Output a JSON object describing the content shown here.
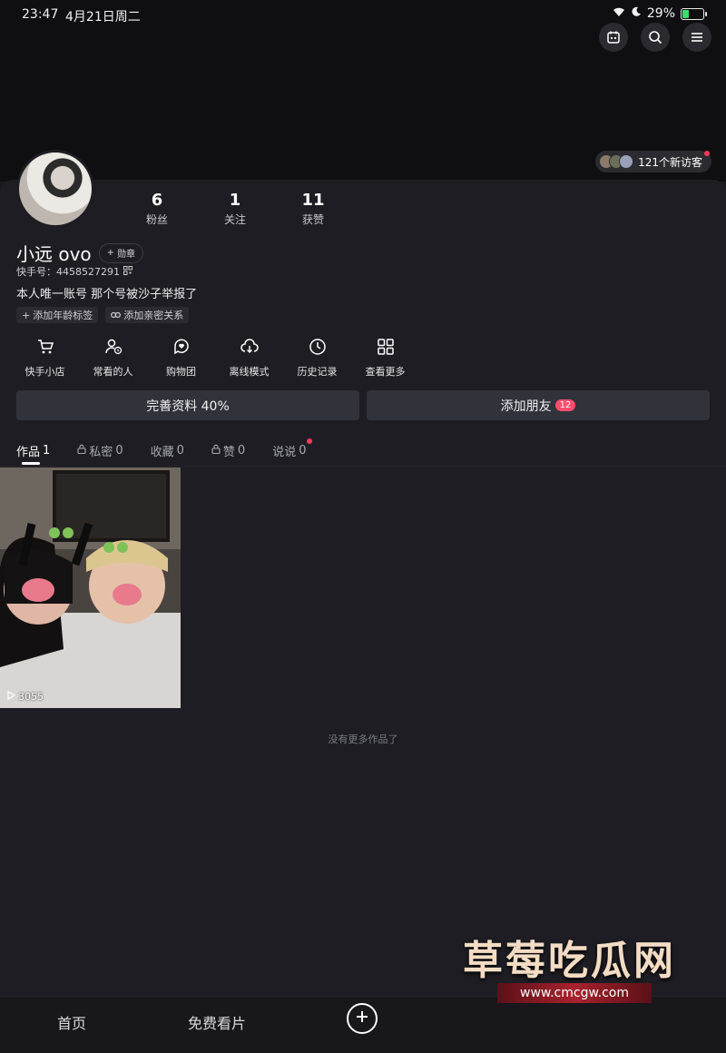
{
  "status": {
    "time": "23:47",
    "date": "4月21日周二",
    "battery": "29%",
    "battery_level": 0.29
  },
  "header_icons": [
    "calendar-icon",
    "search-icon",
    "menu-icon"
  ],
  "visitors": {
    "text": "121个新访客"
  },
  "stats": [
    {
      "num": "6",
      "label": "粉丝"
    },
    {
      "num": "1",
      "label": "关注"
    },
    {
      "num": "11",
      "label": "获赞"
    }
  ],
  "profile": {
    "name": "小远 ovo",
    "badge_label": "勋章",
    "kwai_id": "快手号：4458527291",
    "bio": "本人唯一账号 那个号被沙子举报了"
  },
  "tags": [
    {
      "label": "添加年龄标签",
      "icon": "plus-icon"
    },
    {
      "label": "添加亲密关系",
      "icon": "link-icon"
    }
  ],
  "shortcuts": [
    {
      "label": "快手小店",
      "icon": "cart-icon"
    },
    {
      "label": "常看的人",
      "icon": "person-clock-icon"
    },
    {
      "label": "购物团",
      "icon": "heart-bubble-icon"
    },
    {
      "label": "离线模式",
      "icon": "download-icon"
    },
    {
      "label": "历史记录",
      "icon": "clock-icon"
    },
    {
      "label": "查看更多",
      "icon": "grid-icon"
    }
  ],
  "actions": {
    "complete_profile": "完善资料 40%",
    "add_friend": "添加朋友",
    "add_friend_count": "12"
  },
  "tabs": [
    {
      "label": "作品",
      "count": "1",
      "locked": false,
      "active": true
    },
    {
      "label": "私密",
      "count": "0",
      "locked": true,
      "active": false
    },
    {
      "label": "收藏",
      "count": "0",
      "locked": false,
      "active": false
    },
    {
      "label": "赞",
      "count": "0",
      "locked": true,
      "active": false
    },
    {
      "label": "说说",
      "count": "0",
      "locked": false,
      "active": false
    }
  ],
  "works": [
    {
      "views": "3055"
    }
  ],
  "no_more_text": "没有更多作品了",
  "bottom_nav": {
    "home": "首页",
    "free_watch": "免费看片"
  },
  "watermark": {
    "title": "草莓吃瓜网",
    "url": "www.cmcgw.com"
  },
  "colors": {
    "accent_red": "#ff3b5c",
    "battery_green": "#3ddc6a",
    "card_bg": "#1d1d23"
  }
}
